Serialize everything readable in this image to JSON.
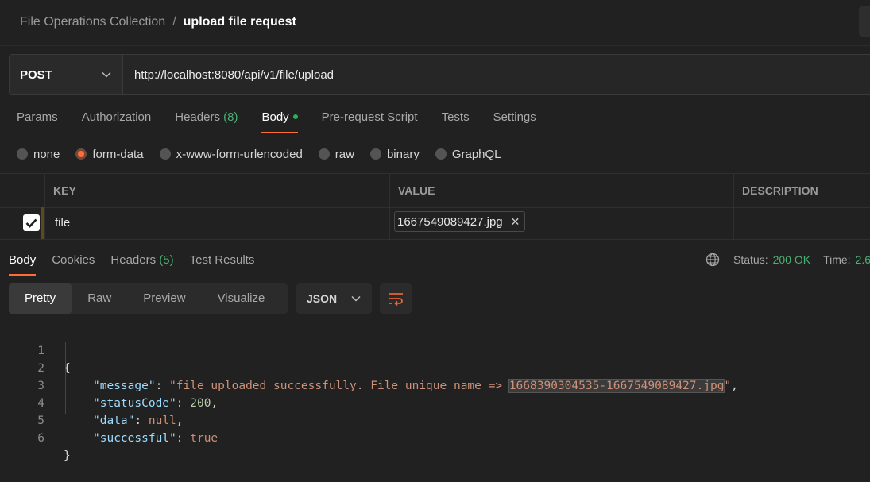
{
  "breadcrumb": {
    "parent": "File Operations Collection",
    "separator": "/",
    "current": "upload file request"
  },
  "request": {
    "method": "POST",
    "url": "http://localhost:8080/api/v1/file/upload",
    "tabs": [
      {
        "label": "Params",
        "count": ""
      },
      {
        "label": "Authorization",
        "count": ""
      },
      {
        "label": "Headers",
        "count": "(8)"
      },
      {
        "label": "Body",
        "count": ""
      },
      {
        "label": "Pre-request Script",
        "count": ""
      },
      {
        "label": "Tests",
        "count": ""
      },
      {
        "label": "Settings",
        "count": ""
      }
    ],
    "active_tab": "Body",
    "body_types": [
      "none",
      "form-data",
      "x-www-form-urlencoded",
      "raw",
      "binary",
      "GraphQL"
    ],
    "selected_body_type": "form-data",
    "table": {
      "headers": [
        "KEY",
        "VALUE",
        "DESCRIPTION"
      ],
      "rows": [
        {
          "checked": true,
          "key": "file",
          "value": "1667549089427.jpg",
          "description": ""
        }
      ]
    }
  },
  "response": {
    "tabs": [
      {
        "label": "Body",
        "count": ""
      },
      {
        "label": "Cookies",
        "count": ""
      },
      {
        "label": "Headers",
        "count": "(5)"
      },
      {
        "label": "Test Results",
        "count": ""
      }
    ],
    "active_tab": "Body",
    "status_label": "Status:",
    "status_value": "200 OK",
    "time_label": "Time:",
    "time_value": "2.6",
    "view_modes": [
      "Pretty",
      "Raw",
      "Preview",
      "Visualize"
    ],
    "active_view": "Pretty",
    "format": "JSON",
    "lines": [
      {
        "num": "1",
        "text": "{"
      },
      {
        "num": "2",
        "key": "\"message\"",
        "value": "\"file uploaded successfully. File unique name => ",
        "highlight": "1668390304535-1667549089427.jpg",
        "tail": "\"",
        "comma": ","
      },
      {
        "num": "3",
        "key": "\"statusCode\"",
        "value": "200",
        "comma": ","
      },
      {
        "num": "4",
        "key": "\"data\"",
        "value": "null",
        "comma": ","
      },
      {
        "num": "5",
        "key": "\"successful\"",
        "value": "true",
        "comma": ""
      },
      {
        "num": "6",
        "text": "}"
      }
    ]
  },
  "colors": {
    "accent": "#ff6c37",
    "success": "#4caf73",
    "background": "#212121"
  }
}
